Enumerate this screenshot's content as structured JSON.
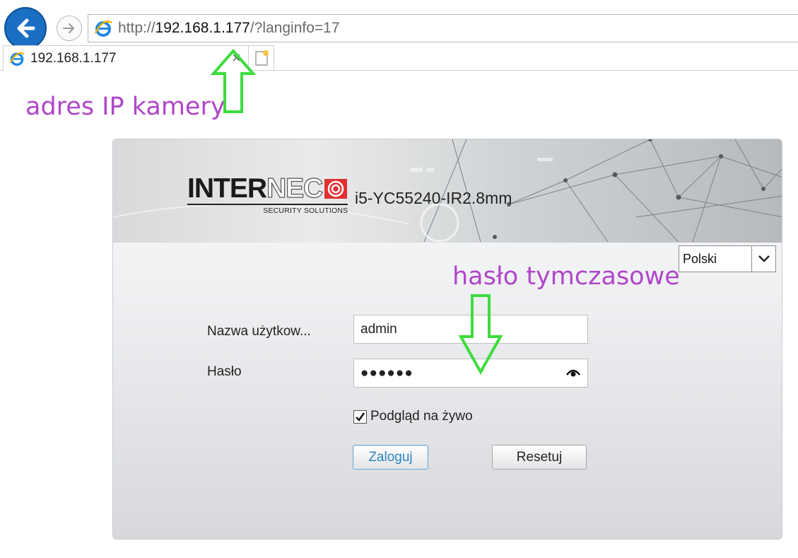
{
  "browser": {
    "url_prefix": "http://",
    "url_host": "192.168.1.177",
    "url_suffix": "/?langinfo=17",
    "tab_title": "192.168.1.177",
    "tab_close": "×"
  },
  "annotations": {
    "ip_note": "adres IP kamery",
    "password_note": "hasło tymczasowe"
  },
  "login": {
    "brand_a": "INTER",
    "brand_b": "NEC",
    "tagline": "SECURITY SOLUTIONS",
    "model": "i5-YC55240-IR2.8mm",
    "language": "Polski",
    "username_label": "Nazwa użytkow...",
    "username_value": "admin",
    "password_label": "Hasło",
    "password_mask": "●●●●●●",
    "live_view_label": "Podgląd na żywo",
    "live_view_checked": true,
    "login_button": "Zaloguj",
    "reset_button": "Resetuj"
  },
  "colors": {
    "annotation": "#b046c9",
    "arrow": "#3ddc3d",
    "login_text": "#2b86c6"
  }
}
